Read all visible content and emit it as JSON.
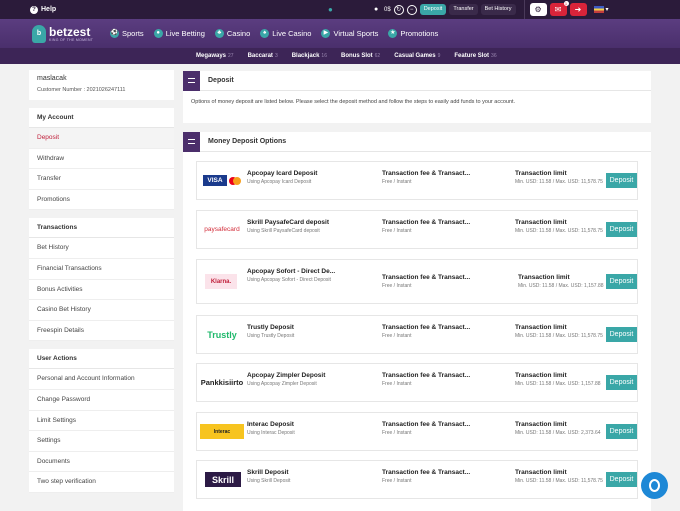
{
  "topbar": {
    "help_label": "Help",
    "balance": "0$",
    "deposit_label": "Deposit",
    "transfer_label": "Transfer",
    "bet_history_label": "Bet History",
    "mail_badge": "1"
  },
  "brand": {
    "name": "betzest",
    "tagline": "KING OF THE MOMENT",
    "accent": "#3aa7a7",
    "nav_bg": "#4a2f6c"
  },
  "nav": {
    "items": [
      {
        "label": "Sports",
        "icon": "soccer-ball-icon"
      },
      {
        "label": "Live Betting",
        "icon": "live-betting-icon"
      },
      {
        "label": "Casino",
        "icon": "casino-chip-icon"
      },
      {
        "label": "Live Casino",
        "icon": "live-casino-icon"
      },
      {
        "label": "Virtual Sports",
        "icon": "virtual-sports-icon"
      },
      {
        "label": "Promotions",
        "icon": "promotions-icon"
      }
    ]
  },
  "subnav": {
    "items": [
      {
        "label": "Megaways",
        "count": "27"
      },
      {
        "label": "Baccarat",
        "count": "3"
      },
      {
        "label": "Blackjack",
        "count": "16"
      },
      {
        "label": "Bonus Slot",
        "count": "62"
      },
      {
        "label": "Casual Games",
        "count": "9"
      },
      {
        "label": "Feature Slot",
        "count": "36"
      }
    ]
  },
  "user": {
    "username": "maslacak",
    "customer_number": "Customer Number : 2021026247111"
  },
  "sidebar": {
    "my_account": {
      "title": "My Account",
      "items": [
        "Deposit",
        "Withdraw",
        "Transfer",
        "Promotions"
      ]
    },
    "transactions": {
      "title": "Transactions",
      "items": [
        "Bet History",
        "Financial Transactions",
        "Bonus Activities",
        "Casino Bet History",
        "Freespin Details"
      ]
    },
    "user_actions": {
      "title": "User Actions",
      "items": [
        "Personal and Account Information",
        "Change Password",
        "Limit Settings",
        "Settings",
        "Documents",
        "Two step verification"
      ]
    }
  },
  "deposit_panel": {
    "title": "Deposit",
    "description": "Options of money deposit are listed below. Please select the deposit method and follow the steps to easily add funds to your account."
  },
  "options_panel": {
    "title": "Money Deposit Options",
    "methods": [
      {
        "name": "Apcopay Icard Deposit",
        "sub": "Using Apcopay Icard Deposit",
        "fee": "Transaction fee & Transact...",
        "fee_sub": "Free / Instant",
        "limit": "Transaction limit",
        "limit_sub": "Min. USD: 11.58 / Max. USD: 11,578.75",
        "button": "Deposit",
        "logo": "VISA"
      },
      {
        "name": "Skrill PaysafeCard deposit",
        "sub": "Using Skrill PaysafeCard deposit",
        "fee": "Transaction fee & Transact...",
        "fee_sub": "Free / Instant",
        "limit": "Transaction limit",
        "limit_sub": "Min. USD: 11.58 / Max. USD: 11,578.75",
        "button": "Deposit",
        "logo": "paysafecard"
      },
      {
        "name": "Apcopay Sofort - Direct De...",
        "sub": "Using Apcopay Sofort - Direct Deposit",
        "fee": "Transaction fee & Transact...",
        "fee_sub": "Free / Instant",
        "limit": "Transaction limit",
        "limit_sub": "Min. USD: 11.58 / Max. USD: 1,157.88",
        "button": "Deposit",
        "logo": "Klarna."
      },
      {
        "name": "Trustly Deposit",
        "sub": "Using Trustly Deposit",
        "fee": "Transaction fee & Transact...",
        "fee_sub": "Free / Instant",
        "limit": "Transaction limit",
        "limit_sub": "Min. USD: 11.58 / Max. USD: 11,578.75",
        "button": "Deposit",
        "logo": "Trustly"
      },
      {
        "name": "Apcopay Zimpler Deposit",
        "sub": "Using Apcopay Zimpler Deposit",
        "fee": "Transaction fee & Transact...",
        "fee_sub": "Free / Instant",
        "limit": "Transaction limit",
        "limit_sub": "Min. USD: 11.58 / Max. USD: 1,157.88",
        "button": "Deposit",
        "logo": "Pankkisiirto"
      },
      {
        "name": "Interac Deposit",
        "sub": "Using Interac Deposit",
        "fee": "Transaction fee & Transact...",
        "fee_sub": "Free / Instant",
        "limit": "Transaction limit",
        "limit_sub": "Min. USD: 11.58 / Max. USD: 2,373.64",
        "button": "Deposit",
        "logo": "Interac"
      },
      {
        "name": "Skrill Deposit",
        "sub": "Using Skrill Deposit",
        "fee": "Transaction fee & Transact...",
        "fee_sub": "Free / Instant",
        "limit": "Transaction limit",
        "limit_sub": "Min. USD: 11.58 / Max. USD: 11,578.75",
        "button": "Deposit",
        "logo": "Skrill"
      }
    ]
  }
}
